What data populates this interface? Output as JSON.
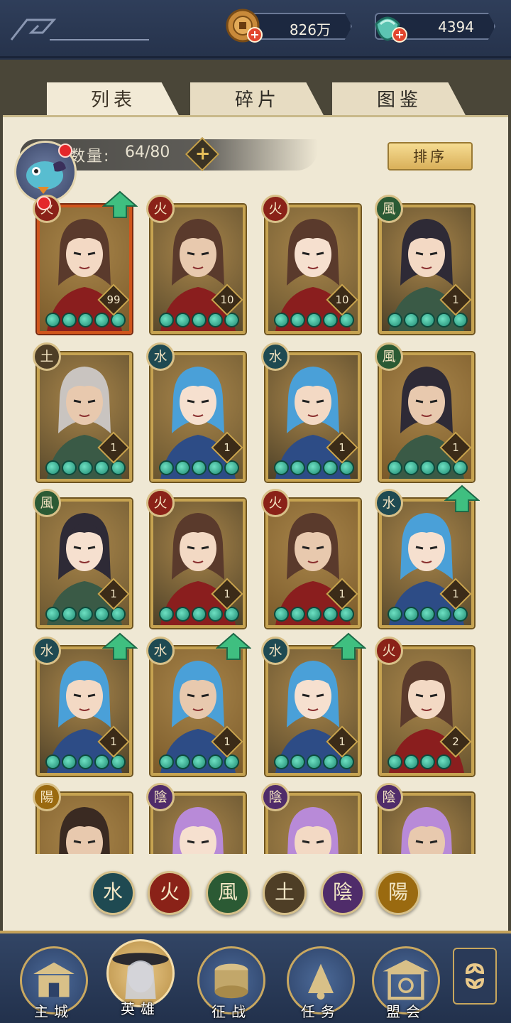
{
  "currencies": {
    "coin": {
      "value": "826万",
      "icon": "copper-coin-icon"
    },
    "jade": {
      "value": "4394",
      "icon": "jade-gem-icon"
    }
  },
  "tabs": [
    {
      "label": "列表",
      "active": true
    },
    {
      "label": "碎片",
      "active": false
    },
    {
      "label": "图鉴",
      "active": false
    }
  ],
  "hero_count": {
    "label": "数量:",
    "value": "64/80"
  },
  "sort_label": "排序",
  "heroes": [
    {
      "element": "火",
      "element_type": "fire",
      "level": "99",
      "stars": 5,
      "upgrade": true
    },
    {
      "element": "火",
      "element_type": "fire",
      "level": "10",
      "stars": 5,
      "upgrade": false
    },
    {
      "element": "火",
      "element_type": "fire",
      "level": "10",
      "stars": 5,
      "upgrade": false
    },
    {
      "element": "風",
      "element_type": "wind",
      "level": "1",
      "stars": 5,
      "upgrade": false
    },
    {
      "element": "土",
      "element_type": "earth",
      "level": "1",
      "stars": 5,
      "upgrade": false
    },
    {
      "element": "水",
      "element_type": "water",
      "level": "1",
      "stars": 5,
      "upgrade": false
    },
    {
      "element": "水",
      "element_type": "water",
      "level": "1",
      "stars": 5,
      "upgrade": false
    },
    {
      "element": "風",
      "element_type": "wind",
      "level": "1",
      "stars": 5,
      "upgrade": false
    },
    {
      "element": "風",
      "element_type": "wind",
      "level": "1",
      "stars": 5,
      "upgrade": false
    },
    {
      "element": "火",
      "element_type": "fire",
      "level": "1",
      "stars": 5,
      "upgrade": false
    },
    {
      "element": "火",
      "element_type": "fire",
      "level": "1",
      "stars": 5,
      "upgrade": false
    },
    {
      "element": "水",
      "element_type": "water",
      "level": "1",
      "stars": 5,
      "upgrade": true
    },
    {
      "element": "水",
      "element_type": "water",
      "level": "1",
      "stars": 5,
      "upgrade": true
    },
    {
      "element": "水",
      "element_type": "water",
      "level": "1",
      "stars": 5,
      "upgrade": true
    },
    {
      "element": "水",
      "element_type": "water",
      "level": "1",
      "stars": 5,
      "upgrade": true
    },
    {
      "element": "火",
      "element_type": "fire",
      "level": "2",
      "stars": 4,
      "upgrade": false
    },
    {
      "element": "陽",
      "element_type": "yang",
      "level": "",
      "stars": 0,
      "upgrade": false
    },
    {
      "element": "陰",
      "element_type": "yin",
      "level": "",
      "stars": 0,
      "upgrade": false
    },
    {
      "element": "陰",
      "element_type": "yin",
      "level": "",
      "stars": 0,
      "upgrade": false
    },
    {
      "element": "陰",
      "element_type": "yin",
      "level": "",
      "stars": 0,
      "upgrade": false
    }
  ],
  "element_filters": [
    {
      "label": "水",
      "type": "water"
    },
    {
      "label": "火",
      "type": "fire"
    },
    {
      "label": "風",
      "type": "wind"
    },
    {
      "label": "土",
      "type": "earth"
    },
    {
      "label": "陰",
      "type": "yin"
    },
    {
      "label": "陽",
      "type": "yang"
    }
  ],
  "nav": [
    {
      "label": "主城",
      "icon": "palace-icon",
      "active": false
    },
    {
      "label": "英雄",
      "icon": "hero-portrait-icon",
      "active": true
    },
    {
      "label": "征战",
      "icon": "drum-icon",
      "active": false
    },
    {
      "label": "任务",
      "icon": "scroll-bell-icon",
      "active": false
    },
    {
      "label": "盟会",
      "icon": "pavilion-icon",
      "active": false
    }
  ],
  "menu_icon": "flower-menu-icon",
  "colors": {
    "fire": "#8a2218",
    "water": "#1f4a52",
    "wind": "#2b5a34",
    "earth": "#4e3e26",
    "yin": "#4f2c6a",
    "yang": "#9a6a10",
    "star": "#2fae8e",
    "upgrade_arrow": "#3fbf80"
  }
}
